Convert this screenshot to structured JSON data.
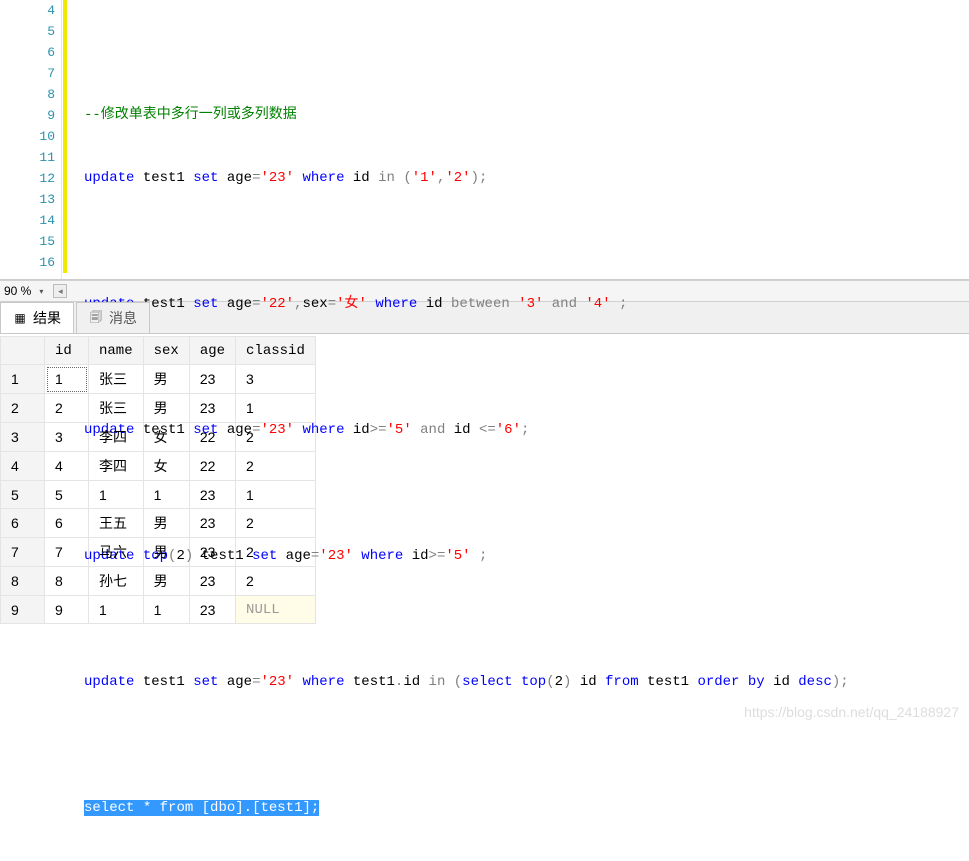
{
  "editor": {
    "line_numbers": [
      "4",
      "5",
      "6",
      "7",
      "8",
      "9",
      "10",
      "11",
      "12",
      "13",
      "14",
      "15",
      "16"
    ],
    "comment": "--修改单表中多行一列或多列数据",
    "lines": {
      "l6": {
        "p1": "update",
        "p2": " test1 ",
        "p3": "set",
        "p4": " age",
        "p5": "=",
        "p6": "'23'",
        "p7": " where",
        "p8": " id ",
        "p9": "in",
        "p10": " (",
        "p11": "'1'",
        "p12": ",",
        "p13": "'2'",
        "p14": ");"
      },
      "l8": {
        "p1": "update",
        "p2": " test1 ",
        "p3": "set",
        "p4": " age",
        "p5": "=",
        "p6": "'22'",
        "p7": ",",
        "p8": "sex",
        "p9": "=",
        "p10": "'女'",
        "p11": " where",
        "p12": " id ",
        "p13": "between",
        "p14": " '3'",
        "p15": " and",
        "p16": " '4'",
        "p17": " ;"
      },
      "l10": {
        "p1": "update",
        "p2": " test1 ",
        "p3": "set",
        "p4": " age",
        "p5": "=",
        "p6": "'23'",
        "p7": " where",
        "p8": " id",
        "p9": ">=",
        "p10": "'5'",
        "p11": " and",
        "p12": " id ",
        "p13": "<=",
        "p14": "'6'",
        "p15": ";"
      },
      "l12": {
        "p1": "update",
        "p2": " top",
        "p3": "(",
        "p4": "2",
        "p5": ")",
        "p6": " test1 ",
        "p7": "set",
        "p8": " age",
        "p9": "=",
        "p10": "'23'",
        "p11": " where",
        "p12": " id",
        "p13": ">=",
        "p14": "'5'",
        "p15": " ;"
      },
      "l14": {
        "p1": "update",
        "p2": " test1 ",
        "p3": "set",
        "p4": " age",
        "p5": "=",
        "p6": "'23'",
        "p7": " where",
        "p8": " test1",
        "p9": ".",
        "p10": "id ",
        "p11": "in",
        "p12": " (",
        "p13": "select",
        "p14": " top",
        "p15": "(",
        "p16": "2",
        "p17": ")",
        "p18": " id ",
        "p19": "from",
        "p20": " test1 ",
        "p21": "order by",
        "p22": " id ",
        "p23": "desc",
        "p24": ");"
      },
      "l16": {
        "p1": "select",
        "p2": " * ",
        "p3": "from",
        "p4": " [dbo]",
        "p5": ".",
        "p6": "[test1]",
        "p7": ";"
      }
    }
  },
  "zoom": {
    "label": "90 %"
  },
  "tabs": {
    "results_icon": "▦",
    "results_label": "结果",
    "messages_icon": "🗐",
    "messages_label": "消息"
  },
  "grid": {
    "headers": {
      "blank": "",
      "c1": "id",
      "c2": "name",
      "c3": "sex",
      "c4": "age",
      "c5": "classid"
    },
    "rows": [
      {
        "n": "1",
        "id": "1",
        "name": "张三",
        "sex": "男",
        "age": "23",
        "classid": "3"
      },
      {
        "n": "2",
        "id": "2",
        "name": "张三",
        "sex": "男",
        "age": "23",
        "classid": "1"
      },
      {
        "n": "3",
        "id": "3",
        "name": "李四",
        "sex": "女",
        "age": "22",
        "classid": "2"
      },
      {
        "n": "4",
        "id": "4",
        "name": "李四",
        "sex": "女",
        "age": "22",
        "classid": "2"
      },
      {
        "n": "5",
        "id": "5",
        "name": "1",
        "sex": "1",
        "age": "23",
        "classid": "1"
      },
      {
        "n": "6",
        "id": "6",
        "name": "王五",
        "sex": "男",
        "age": "23",
        "classid": "2"
      },
      {
        "n": "7",
        "id": "7",
        "name": "马六",
        "sex": "男",
        "age": "23",
        "classid": "2"
      },
      {
        "n": "8",
        "id": "8",
        "name": "孙七",
        "sex": "男",
        "age": "23",
        "classid": "2"
      },
      {
        "n": "9",
        "id": "9",
        "name": "1",
        "sex": "1",
        "age": "23",
        "classid": "NULL"
      }
    ]
  },
  "watermark": "https://blog.csdn.net/qq_24188927"
}
